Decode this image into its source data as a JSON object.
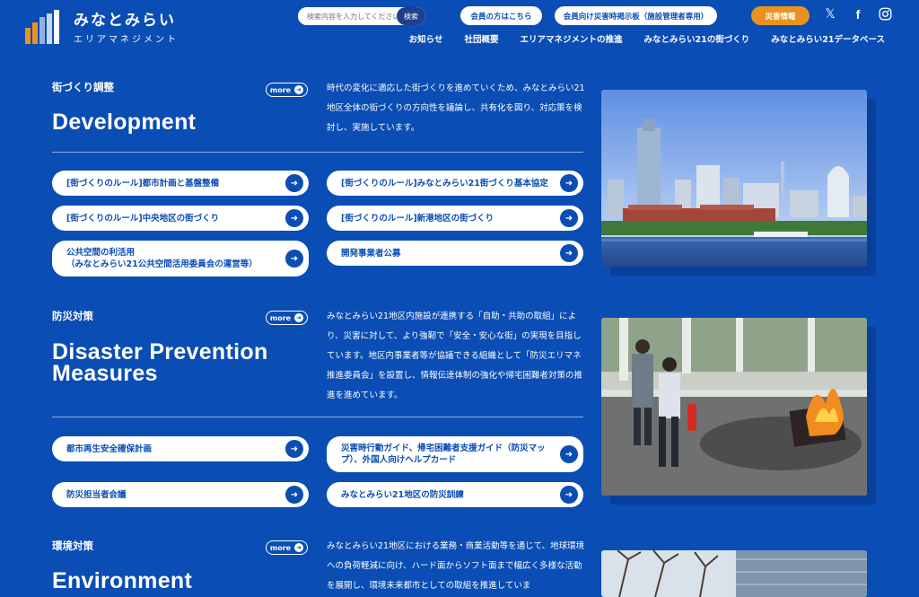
{
  "header": {
    "logo_title": "みなとみらい",
    "logo_sub": "エリアマネジメント",
    "search_placeholder": "検索内容を入力してください",
    "search_button": "検索",
    "member_link": "会員の方はこちら",
    "disaster_board": "会員向け災害時掲示板（施設管理者専用）",
    "disaster_info": "災害情報",
    "social": [
      "x-icon",
      "facebook-icon",
      "instagram-icon"
    ],
    "nav": [
      "お知らせ",
      "社団概要",
      "エリアマネジメントの推進",
      "みなとみらい21の街づくり",
      "みなとみらい21データベース"
    ]
  },
  "more_label": "more",
  "sections": [
    {
      "label": "街づくり調整",
      "title": "Development",
      "desc": "時代の変化に適応した街づくりを進めていくため、みなとみらい21地区全体の街づくりの方向性を議論し、共有化を図り、対応策を検討し、実施しています。",
      "links": [
        "[街づくりのルール]都市計画と基盤整備",
        "[街づくりのルール]みなとみらい21街づくり基本協定",
        "[街づくりのルール]中央地区の街づくり",
        "[街づくりのルール]新港地区の街づくり",
        "公共空間の利活用\n（みなとみらい21公共空間活用委員会の運営等）",
        "開発事業者公募"
      ]
    },
    {
      "label": "防災対策",
      "title": "Disaster Prevention\nMeasures",
      "desc": "みなとみらい21地区内施設が連携する「自助・共助の取組」により、災害に対して、より強靭で「安全・安心な街」の実現を目指しています。地区内事業者等が協議できる組織として「防災エリマネ推進委員会」を設置し、情報伝達体制の強化や帰宅困難者対策の推進を進めています。",
      "links": [
        "都市再生安全確保計画",
        "災害時行動ガイド、帰宅困難者支援ガイド（防災マップ）、外国人向けヘルプカード",
        "防災担当者会議",
        "みなとみらい21地区の防災訓練"
      ]
    },
    {
      "label": "環境対策",
      "title": "Environment",
      "desc": "みなとみらい21地区における業務・商業活動等を通じて、地球環境への負荷軽減に向け、ハード面からソフト面まで幅広く多様な活動を展開し、環境未来都市としての取組を推進していま"
    }
  ],
  "colors": {
    "background": "#0a4db4",
    "accent": "#e8931e",
    "white": "#ffffff"
  }
}
